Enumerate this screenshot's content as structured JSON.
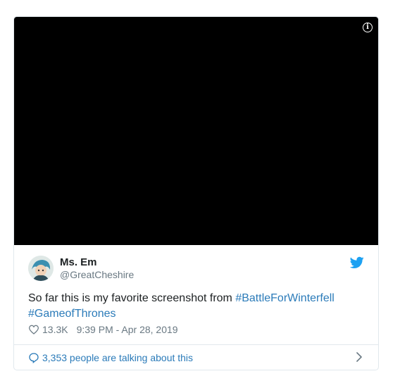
{
  "tweet": {
    "author_name": "Ms. Em",
    "author_handle": "@GreatCheshire",
    "text_plain": "So far this is my favorite screenshot from ",
    "hashtag_1": "#BattleForWinterfell",
    "hashtag_2": "#GameofThrones",
    "likes": "13.3K",
    "timestamp": "9:39 PM - Apr 28, 2019",
    "conversation_link": "3,353 people are talking about this"
  },
  "icons": {
    "info": "info-icon",
    "platform": "twitter-bird-icon",
    "like": "heart-icon",
    "reply": "speech-bubble-icon",
    "more": "chevron-right-icon"
  },
  "colors": {
    "link": "#2b7bb9",
    "brand": "#1da1f2",
    "secondary_text": "#697882",
    "border": "#e1e8ed"
  }
}
